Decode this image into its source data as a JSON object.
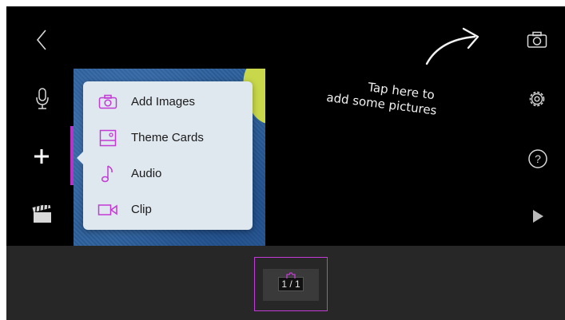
{
  "toolbar_left": {
    "back": "back-chevron",
    "mic": "microphone",
    "add": "plus",
    "clapper": "clapperboard"
  },
  "toolbar_right": {
    "camera": "camera",
    "settings": "gear",
    "help_label": "?",
    "play": "play"
  },
  "menu": {
    "items": [
      {
        "label": "Add Images",
        "icon": "camera-icon"
      },
      {
        "label": "Theme Cards",
        "icon": "theme-card-icon"
      },
      {
        "label": "Audio",
        "icon": "music-note-icon"
      },
      {
        "label": "Clip",
        "icon": "video-camera-icon"
      }
    ]
  },
  "hint": {
    "line1": "Tap here to",
    "line2": "add some pictures"
  },
  "timeline": {
    "clip_counter": "1 / 1"
  },
  "colors": {
    "accent": "#c43ad6",
    "menu_background": "#dfe7ef",
    "timeline_background": "#272727"
  }
}
